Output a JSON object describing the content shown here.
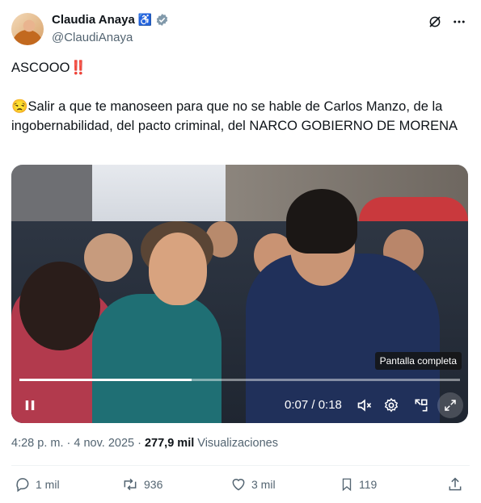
{
  "author": {
    "name": "Claudia Anaya",
    "handle": "@ClaudiAnaya"
  },
  "tweet": {
    "line1": "ASCOOO",
    "line1_emoji": "‼️",
    "body_emoji": "😒",
    "body": "Salir a que te manoseen para que no se hable de Carlos Manzo, de la ingobernabilidad, del pacto criminal, del NARCO GOBIERNO DE MORENA"
  },
  "video": {
    "tooltip": "Pantalla completa",
    "time": "0:07 / 0:18",
    "progress": 0.39
  },
  "meta": {
    "time": "4:28 p. m.",
    "date": "4 nov. 2025",
    "views": "277,9 mil",
    "views_label": "Visualizaciones"
  },
  "actions": {
    "replies": "1 mil",
    "reposts": "936",
    "likes": "3 mil",
    "bookmarks": "119"
  },
  "colors": {
    "text": "#0f1419",
    "secondary": "#536471",
    "verified": "#829aab"
  }
}
